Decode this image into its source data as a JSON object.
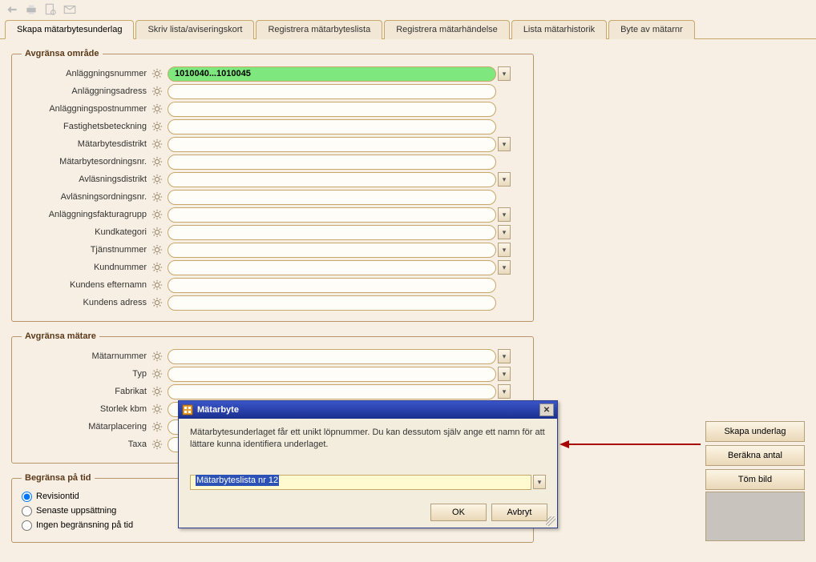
{
  "tabs": [
    {
      "label": "Skapa mätarbytesunderlag"
    },
    {
      "label": "Skriv lista/aviseringskort"
    },
    {
      "label": "Registrera mätarbyteslista"
    },
    {
      "label": "Registrera mätarhändelse"
    },
    {
      "label": "Lista mätarhistorik"
    },
    {
      "label": "Byte av mätarnr"
    }
  ],
  "group_area": {
    "legend": "Avgränsa område",
    "rows": [
      {
        "label": "Anläggningsnummer",
        "value": "1010040...1010045",
        "dd": true,
        "green": true
      },
      {
        "label": "Anläggningsadress",
        "value": "",
        "dd": false
      },
      {
        "label": "Anläggningspostnummer",
        "value": "",
        "dd": false
      },
      {
        "label": "Fastighetsbeteckning",
        "value": "",
        "dd": false
      },
      {
        "label": "Mätarbytesdistrikt",
        "value": "",
        "dd": true
      },
      {
        "label": "Mätarbytesordningsnr.",
        "value": "",
        "dd": false
      },
      {
        "label": "Avläsningsdistrikt",
        "value": "",
        "dd": true
      },
      {
        "label": "Avläsningsordningsnr.",
        "value": "",
        "dd": false
      },
      {
        "label": "Anläggningsfakturagrupp",
        "value": "",
        "dd": true
      },
      {
        "label": "Kundkategori",
        "value": "",
        "dd": true
      },
      {
        "label": "Tjänstnummer",
        "value": "",
        "dd": true
      },
      {
        "label": "Kundnummer",
        "value": "",
        "dd": true
      },
      {
        "label": "Kundens efternamn",
        "value": "",
        "dd": false
      },
      {
        "label": "Kundens adress",
        "value": "",
        "dd": false
      }
    ]
  },
  "group_meter": {
    "legend": "Avgränsa mätare",
    "rows": [
      {
        "label": "Mätarnummer",
        "value": "",
        "dd": true
      },
      {
        "label": "Typ",
        "value": "",
        "dd": true
      },
      {
        "label": "Fabrikat",
        "value": "",
        "dd": true
      },
      {
        "label": "Storlek kbm",
        "value": "",
        "dd": true
      },
      {
        "label": "Mätarplacering",
        "value": "",
        "dd": true
      },
      {
        "label": "Taxa",
        "value": "",
        "dd": true
      }
    ]
  },
  "group_time": {
    "legend": "Begränsa på tid",
    "options": [
      {
        "label": "Revisiontid",
        "checked": true
      },
      {
        "label": "Senaste uppsättning",
        "checked": false
      },
      {
        "label": "Ingen begränsning på tid",
        "checked": false
      }
    ]
  },
  "side": {
    "btn1": "Skapa underlag",
    "btn2": "Beräkna antal",
    "btn3": "Töm bild"
  },
  "modal": {
    "title": "Mätarbyte",
    "text": "Mätarbytesunderlaget får ett unikt löpnummer. Du kan dessutom själv ange ett namn för att lättare kunna identifiera underlaget.",
    "input_value": "Mätarbyteslista nr 12",
    "ok": "OK",
    "cancel": "Avbryt"
  }
}
